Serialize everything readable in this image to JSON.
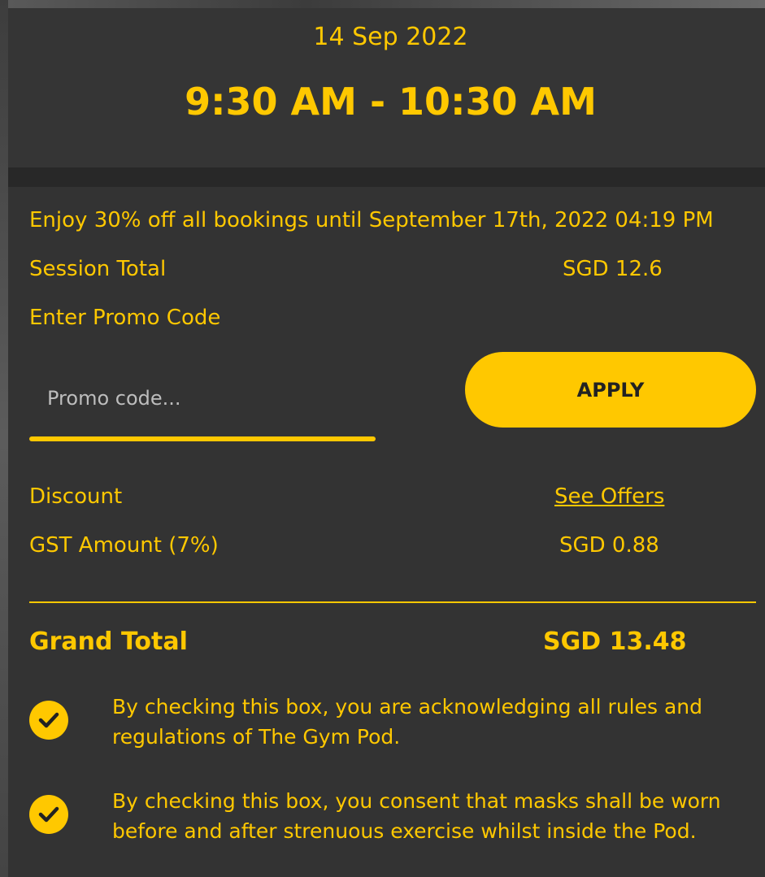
{
  "header": {
    "date": "14 Sep 2022",
    "time_range": "9:30 AM - 10:30 AM"
  },
  "promo_banner": "Enjoy 30% off all bookings until September 17th, 2022 04:19 PM",
  "session_total": {
    "label": "Session Total",
    "value": "SGD 12.6"
  },
  "promo": {
    "label": "Enter Promo Code",
    "placeholder": "Promo code...",
    "value": "",
    "apply_label": "APPLY"
  },
  "discount": {
    "label": "Discount",
    "link": "See Offers"
  },
  "gst": {
    "label": "GST Amount (7%)",
    "value": "SGD 0.88"
  },
  "grand_total": {
    "label": "Grand Total",
    "value": "SGD 13.48"
  },
  "acknowledgements": [
    {
      "checked": true,
      "text": "By checking this box, you are acknowledging all rules and regulations of The Gym Pod."
    },
    {
      "checked": true,
      "text": "By checking this box, you consent that masks shall be worn before and after strenuous exercise whilst inside the Pod."
    }
  ],
  "colors": {
    "accent": "#FFC800",
    "panel": "#333333",
    "header": "#353535"
  },
  "icons": {
    "checkbox": "check-circle-icon"
  }
}
